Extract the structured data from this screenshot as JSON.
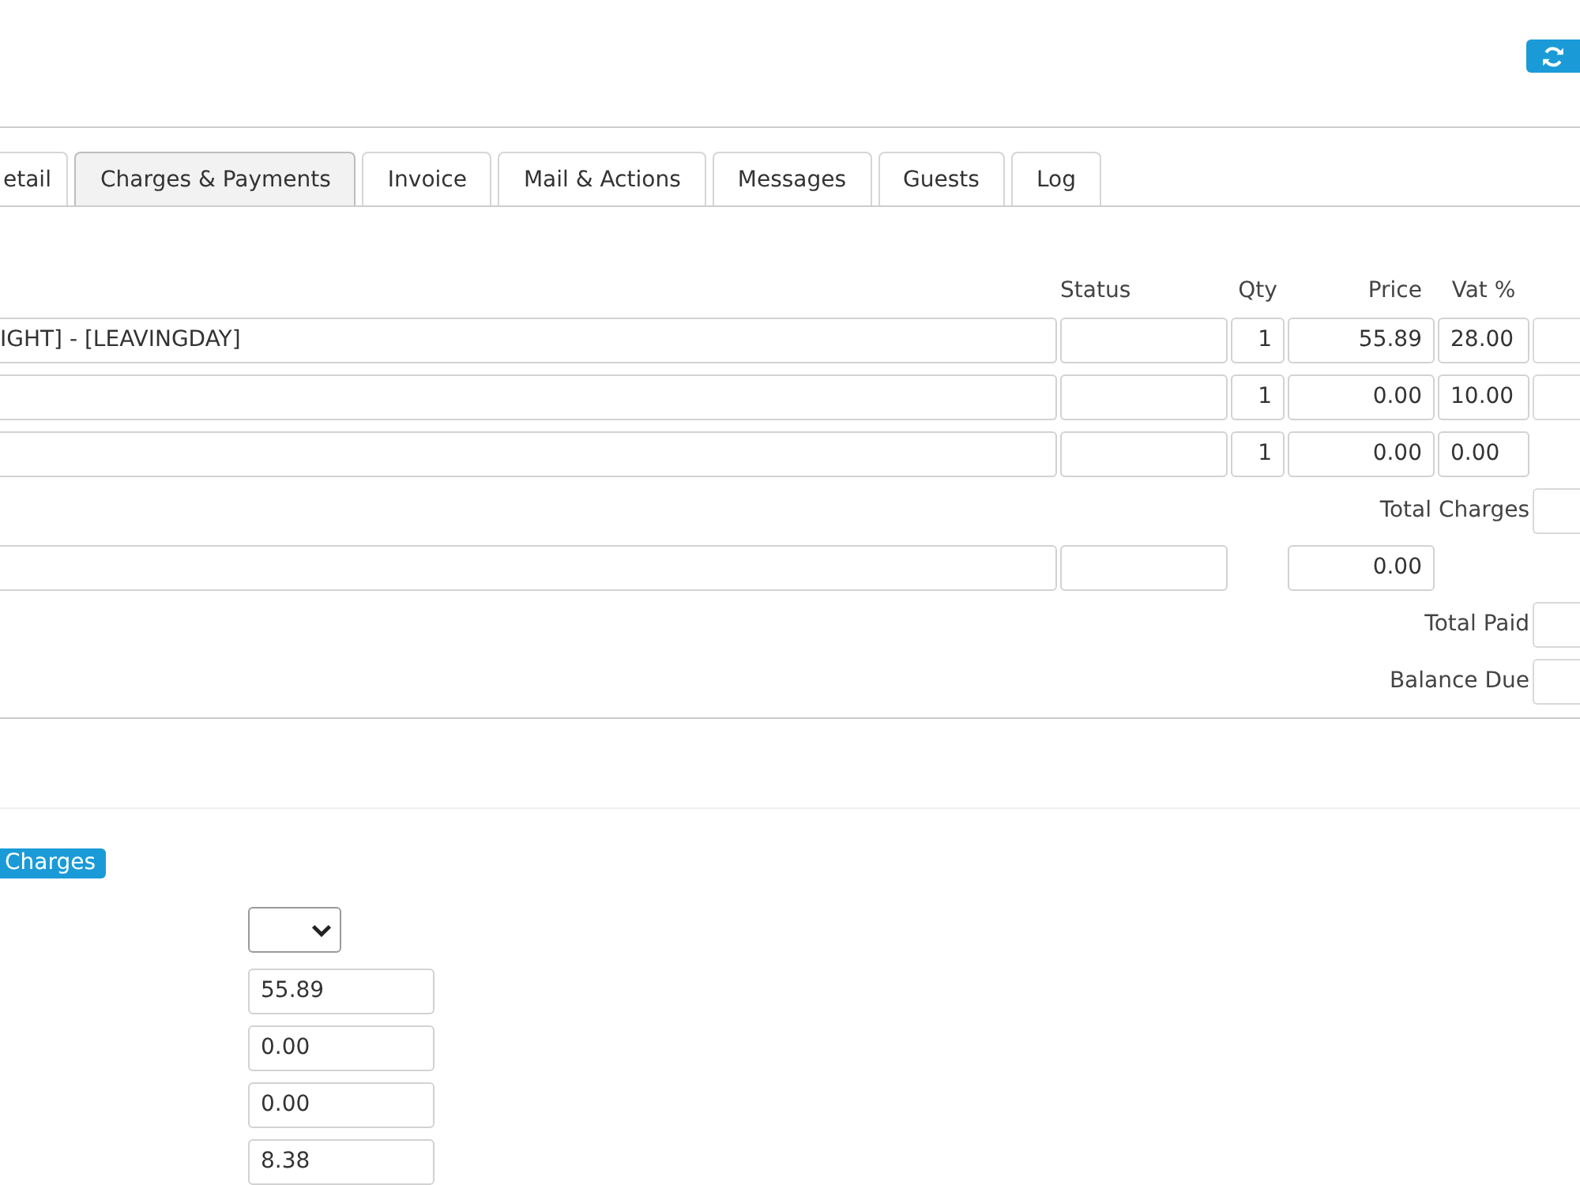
{
  "tabs": [
    {
      "label": "etail",
      "selected": false
    },
    {
      "label": "Charges & Payments",
      "selected": true
    },
    {
      "label": "Invoice",
      "selected": false
    },
    {
      "label": "Mail & Actions",
      "selected": false
    },
    {
      "label": "Messages",
      "selected": false
    },
    {
      "label": "Guests",
      "selected": false
    },
    {
      "label": "Log",
      "selected": false
    }
  ],
  "charges": {
    "columns": [
      "Status",
      "Qty",
      "Price",
      "Vat %"
    ],
    "rows": [
      {
        "description": "IGHT] - [LEAVINGDAY]",
        "qty": "1",
        "price": "55.89",
        "vat": "28.00",
        "total_field": true
      },
      {
        "qty": "1",
        "price": "0.00",
        "vat": "10.00",
        "total_field": true
      },
      {
        "qty": "1",
        "price": "0.00",
        "vat": "0.00",
        "total_field": false
      }
    ],
    "total_label": "Total Charges"
  },
  "payments": {
    "rows": [
      {
        "amount": "0.00"
      }
    ],
    "total_paid_label": "Total Paid",
    "balance_due_label": "Balance Due"
  },
  "charges_button": {
    "label": "Charges"
  },
  "form": {
    "fields": [
      {
        "kind": "select"
      },
      {
        "kind": "text",
        "value": "55.89"
      },
      {
        "kind": "text",
        "value": "0.00"
      },
      {
        "kind": "text",
        "value": "0.00"
      },
      {
        "kind": "text",
        "value": "8.38"
      }
    ]
  }
}
